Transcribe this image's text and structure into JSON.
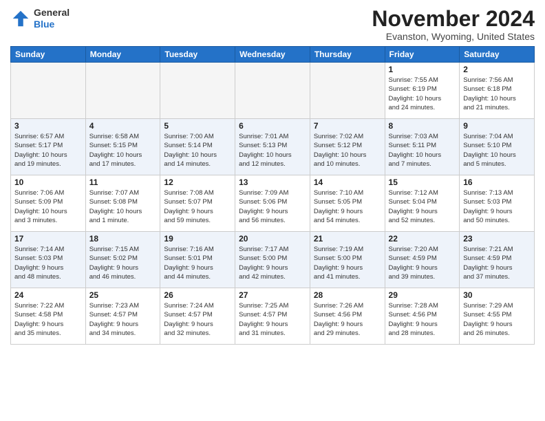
{
  "logo": {
    "general": "General",
    "blue": "Blue"
  },
  "title": "November 2024",
  "location": "Evanston, Wyoming, United States",
  "weekdays": [
    "Sunday",
    "Monday",
    "Tuesday",
    "Wednesday",
    "Thursday",
    "Friday",
    "Saturday"
  ],
  "weeks": [
    [
      {
        "day": "",
        "info": ""
      },
      {
        "day": "",
        "info": ""
      },
      {
        "day": "",
        "info": ""
      },
      {
        "day": "",
        "info": ""
      },
      {
        "day": "",
        "info": ""
      },
      {
        "day": "1",
        "info": "Sunrise: 7:55 AM\nSunset: 6:19 PM\nDaylight: 10 hours\nand 24 minutes."
      },
      {
        "day": "2",
        "info": "Sunrise: 7:56 AM\nSunset: 6:18 PM\nDaylight: 10 hours\nand 21 minutes."
      }
    ],
    [
      {
        "day": "3",
        "info": "Sunrise: 6:57 AM\nSunset: 5:17 PM\nDaylight: 10 hours\nand 19 minutes."
      },
      {
        "day": "4",
        "info": "Sunrise: 6:58 AM\nSunset: 5:15 PM\nDaylight: 10 hours\nand 17 minutes."
      },
      {
        "day": "5",
        "info": "Sunrise: 7:00 AM\nSunset: 5:14 PM\nDaylight: 10 hours\nand 14 minutes."
      },
      {
        "day": "6",
        "info": "Sunrise: 7:01 AM\nSunset: 5:13 PM\nDaylight: 10 hours\nand 12 minutes."
      },
      {
        "day": "7",
        "info": "Sunrise: 7:02 AM\nSunset: 5:12 PM\nDaylight: 10 hours\nand 10 minutes."
      },
      {
        "day": "8",
        "info": "Sunrise: 7:03 AM\nSunset: 5:11 PM\nDaylight: 10 hours\nand 7 minutes."
      },
      {
        "day": "9",
        "info": "Sunrise: 7:04 AM\nSunset: 5:10 PM\nDaylight: 10 hours\nand 5 minutes."
      }
    ],
    [
      {
        "day": "10",
        "info": "Sunrise: 7:06 AM\nSunset: 5:09 PM\nDaylight: 10 hours\nand 3 minutes."
      },
      {
        "day": "11",
        "info": "Sunrise: 7:07 AM\nSunset: 5:08 PM\nDaylight: 10 hours\nand 1 minute."
      },
      {
        "day": "12",
        "info": "Sunrise: 7:08 AM\nSunset: 5:07 PM\nDaylight: 9 hours\nand 59 minutes."
      },
      {
        "day": "13",
        "info": "Sunrise: 7:09 AM\nSunset: 5:06 PM\nDaylight: 9 hours\nand 56 minutes."
      },
      {
        "day": "14",
        "info": "Sunrise: 7:10 AM\nSunset: 5:05 PM\nDaylight: 9 hours\nand 54 minutes."
      },
      {
        "day": "15",
        "info": "Sunrise: 7:12 AM\nSunset: 5:04 PM\nDaylight: 9 hours\nand 52 minutes."
      },
      {
        "day": "16",
        "info": "Sunrise: 7:13 AM\nSunset: 5:03 PM\nDaylight: 9 hours\nand 50 minutes."
      }
    ],
    [
      {
        "day": "17",
        "info": "Sunrise: 7:14 AM\nSunset: 5:03 PM\nDaylight: 9 hours\nand 48 minutes."
      },
      {
        "day": "18",
        "info": "Sunrise: 7:15 AM\nSunset: 5:02 PM\nDaylight: 9 hours\nand 46 minutes."
      },
      {
        "day": "19",
        "info": "Sunrise: 7:16 AM\nSunset: 5:01 PM\nDaylight: 9 hours\nand 44 minutes."
      },
      {
        "day": "20",
        "info": "Sunrise: 7:17 AM\nSunset: 5:00 PM\nDaylight: 9 hours\nand 42 minutes."
      },
      {
        "day": "21",
        "info": "Sunrise: 7:19 AM\nSunset: 5:00 PM\nDaylight: 9 hours\nand 41 minutes."
      },
      {
        "day": "22",
        "info": "Sunrise: 7:20 AM\nSunset: 4:59 PM\nDaylight: 9 hours\nand 39 minutes."
      },
      {
        "day": "23",
        "info": "Sunrise: 7:21 AM\nSunset: 4:59 PM\nDaylight: 9 hours\nand 37 minutes."
      }
    ],
    [
      {
        "day": "24",
        "info": "Sunrise: 7:22 AM\nSunset: 4:58 PM\nDaylight: 9 hours\nand 35 minutes."
      },
      {
        "day": "25",
        "info": "Sunrise: 7:23 AM\nSunset: 4:57 PM\nDaylight: 9 hours\nand 34 minutes."
      },
      {
        "day": "26",
        "info": "Sunrise: 7:24 AM\nSunset: 4:57 PM\nDaylight: 9 hours\nand 32 minutes."
      },
      {
        "day": "27",
        "info": "Sunrise: 7:25 AM\nSunset: 4:57 PM\nDaylight: 9 hours\nand 31 minutes."
      },
      {
        "day": "28",
        "info": "Sunrise: 7:26 AM\nSunset: 4:56 PM\nDaylight: 9 hours\nand 29 minutes."
      },
      {
        "day": "29",
        "info": "Sunrise: 7:28 AM\nSunset: 4:56 PM\nDaylight: 9 hours\nand 28 minutes."
      },
      {
        "day": "30",
        "info": "Sunrise: 7:29 AM\nSunset: 4:55 PM\nDaylight: 9 hours\nand 26 minutes."
      }
    ]
  ]
}
